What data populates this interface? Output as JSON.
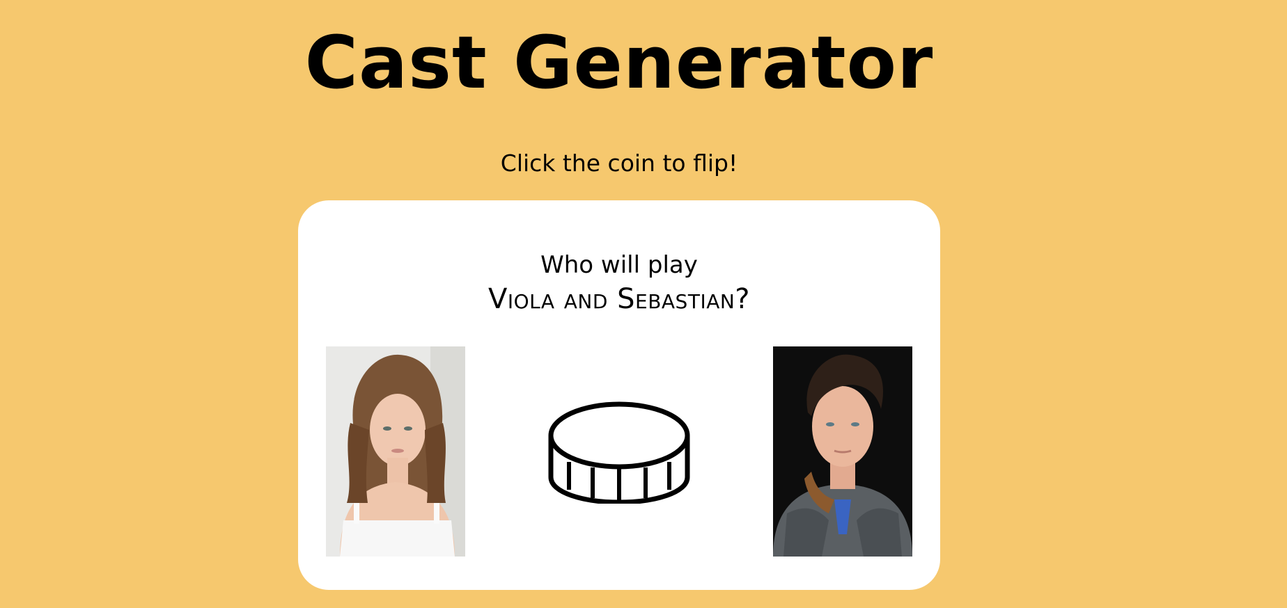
{
  "title": "Cast Generator",
  "instruction": "Click the coin to flip!",
  "card": {
    "question_prefix": "Who will play",
    "question_roles": "Viola and Sebastian?"
  },
  "actors": [
    {
      "name": "actor-left-portrait",
      "icon": "portrait-photo"
    },
    {
      "name": "actor-right-portrait",
      "icon": "portrait-photo"
    }
  ],
  "coin": {
    "icon": "coin-icon"
  },
  "colors": {
    "background": "#F6C86E",
    "card": "#FFFFFF",
    "text": "#000000"
  }
}
